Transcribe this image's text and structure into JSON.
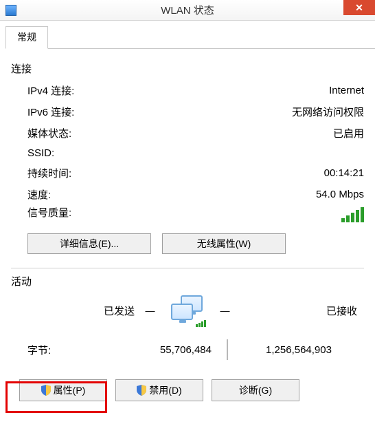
{
  "window": {
    "title": "WLAN 状态",
    "close": "✕"
  },
  "tabs": {
    "general": "常规"
  },
  "connection": {
    "section": "连接",
    "ipv4_label": "IPv4 连接:",
    "ipv4_value": "Internet",
    "ipv6_label": "IPv6 连接:",
    "ipv6_value": "无网络访问权限",
    "media_label": "媒体状态:",
    "media_value": "已启用",
    "ssid_label": "SSID:",
    "ssid_value": "",
    "duration_label": "持续时间:",
    "duration_value": "00:14:21",
    "speed_label": "速度:",
    "speed_value": "54.0 Mbps",
    "signal_label": "信号质量:"
  },
  "buttons": {
    "details": "详细信息(E)...",
    "wireless_props": "无线属性(W)",
    "properties": "属性(P)",
    "disable": "禁用(D)",
    "diagnose": "诊断(G)"
  },
  "activity": {
    "section": "活动",
    "sent": "已发送",
    "recv": "已接收",
    "bytes_label": "字节:",
    "bytes_sent": "55,706,484",
    "bytes_recv": "1,256,564,903"
  }
}
